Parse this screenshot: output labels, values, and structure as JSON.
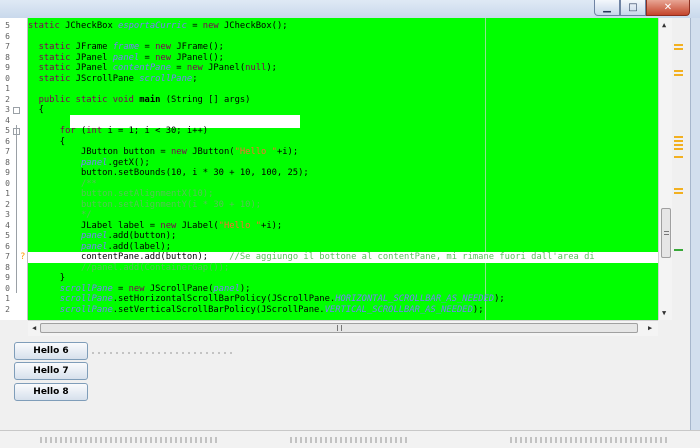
{
  "window": {
    "minimize_glyph": "▁",
    "maximize_glyph": "□",
    "close_glyph": "✕"
  },
  "gutter": {
    "line_numbers": [
      "5",
      "6",
      "7",
      "8",
      "9",
      "0",
      "1",
      "2",
      "3",
      "4",
      "5",
      "6",
      "7",
      "8",
      "9",
      "0",
      "1",
      "2",
      "3",
      "4",
      "5",
      "6",
      "7",
      "8",
      "9",
      "0",
      "1",
      "2"
    ],
    "fold_rows": [
      8,
      10
    ]
  },
  "code": {
    "lines": [
      [
        {
          "t": "static ",
          "c": "kw"
        },
        {
          "t": "JCheckBox "
        },
        {
          "t": "esportaCurric",
          "c": "fld"
        },
        {
          "t": " = "
        },
        {
          "t": "new ",
          "c": "kw"
        },
        {
          "t": "JCheckBox();"
        }
      ],
      [],
      [
        {
          "t": "  static ",
          "c": "kw"
        },
        {
          "t": "JFrame "
        },
        {
          "t": "frame",
          "c": "fld"
        },
        {
          "t": " = "
        },
        {
          "t": "new ",
          "c": "kw"
        },
        {
          "t": "JFrame();"
        }
      ],
      [
        {
          "t": "  static ",
          "c": "kw"
        },
        {
          "t": "JPanel "
        },
        {
          "t": "panel",
          "c": "fld"
        },
        {
          "t": " = "
        },
        {
          "t": "new ",
          "c": "kw"
        },
        {
          "t": "JPanel();"
        }
      ],
      [
        {
          "t": "  static ",
          "c": "kw"
        },
        {
          "t": "JPanel "
        },
        {
          "t": "contentPane",
          "c": "fld"
        },
        {
          "t": " = "
        },
        {
          "t": "new ",
          "c": "kw"
        },
        {
          "t": "JPanel("
        },
        {
          "t": "null",
          "c": "kw"
        },
        {
          "t": ");"
        }
      ],
      [
        {
          "t": "  static ",
          "c": "kw"
        },
        {
          "t": "JScrollPane "
        },
        {
          "t": "scrollPane",
          "c": "fld"
        },
        {
          "t": ";"
        }
      ],
      [],
      [
        {
          "t": "  public static void ",
          "c": "kw"
        },
        {
          "t": "main",
          "c": "fn"
        },
        {
          "t": " (String [] args)"
        }
      ],
      [
        {
          "t": "  {"
        }
      ],
      [],
      [
        {
          "t": "      for ",
          "c": "kw"
        },
        {
          "t": "("
        },
        {
          "t": "int ",
          "c": "kw"
        },
        {
          "t": "i = 1; i < 30; i++)"
        }
      ],
      [
        {
          "t": "      {"
        }
      ],
      [
        {
          "t": "          JButton button = "
        },
        {
          "t": "new ",
          "c": "kw"
        },
        {
          "t": "JButton("
        },
        {
          "t": "\"Hello \"",
          "c": "str"
        },
        {
          "t": "+i);"
        }
      ],
      [
        {
          "t": "          "
        },
        {
          "t": "panel",
          "c": "fld"
        },
        {
          "t": ".getX();"
        }
      ],
      [
        {
          "t": "          button.setBounds(10, i * 30 + 10, 100, 25);"
        }
      ],
      [
        {
          "t": "          /**",
          "c": "cmt"
        }
      ],
      [
        {
          "t": "          button.setAlignmentX(10);",
          "c": "cmt"
        }
      ],
      [
        {
          "t": "          button.setAlignmentY(i * 30 + 10);",
          "c": "cmt"
        }
      ],
      [
        {
          "t": "          */",
          "c": "cmt"
        }
      ],
      [
        {
          "t": "          JLabel label = "
        },
        {
          "t": "new ",
          "c": "kw"
        },
        {
          "t": "JLabel("
        },
        {
          "t": "\"Hello \"",
          "c": "str"
        },
        {
          "t": "+i);"
        }
      ],
      [
        {
          "t": "          "
        },
        {
          "t": "panel",
          "c": "fld"
        },
        {
          "t": ".add(button);"
        }
      ],
      [
        {
          "t": "          "
        },
        {
          "t": "panel",
          "c": "fld"
        },
        {
          "t": ".add(label);"
        }
      ],
      [
        {
          "t": "          contentPane.add(button);    "
        },
        {
          "t": "//Se aggiungo il bottone al contentPane, mi rimane fuori dall'area di",
          "c": "cmt"
        }
      ],
      [
        {
          "t": "          //panel.add(ContainerGap());",
          "c": "cmt"
        }
      ],
      [
        {
          "t": "      }"
        }
      ],
      [
        {
          "t": "      "
        },
        {
          "t": "scrollPane",
          "c": "fld"
        },
        {
          "t": " = "
        },
        {
          "t": "new ",
          "c": "kw"
        },
        {
          "t": "JScrollPane("
        },
        {
          "t": "panel",
          "c": "fld"
        },
        {
          "t": ");"
        }
      ],
      [
        {
          "t": "      "
        },
        {
          "t": "scrollPane",
          "c": "fld"
        },
        {
          "t": ".setHorizontalScrollBarPolicy(JScrollPane."
        },
        {
          "t": "HORIZONTAL_SCROLLBAR_AS_NEEDED",
          "c": "fld"
        },
        {
          "t": ");"
        }
      ],
      [
        {
          "t": "      "
        },
        {
          "t": "scrollPane",
          "c": "fld"
        },
        {
          "t": ".setVerticalScrollBarPolicy(JScrollPane."
        },
        {
          "t": "VERTICAL_SCROLLBAR_AS_NEEDED",
          "c": "fld"
        },
        {
          "t": ");"
        }
      ]
    ],
    "highlighted_line": 22,
    "warning_marker_line": 22
  },
  "colors": {
    "editor_background": "#00ff00",
    "keyword": "#7f0055",
    "field": "#7a7aff",
    "string": "#ff6633",
    "comment": "#58c058"
  },
  "scrollbars": {
    "up_arrow": "▲",
    "down_arrow": "▼",
    "left_arrow": "◀",
    "right_arrow": "▶"
  },
  "buttons": [
    {
      "label": "Hello 6"
    },
    {
      "label": "Hello 7"
    },
    {
      "label": "Hello 8"
    }
  ]
}
